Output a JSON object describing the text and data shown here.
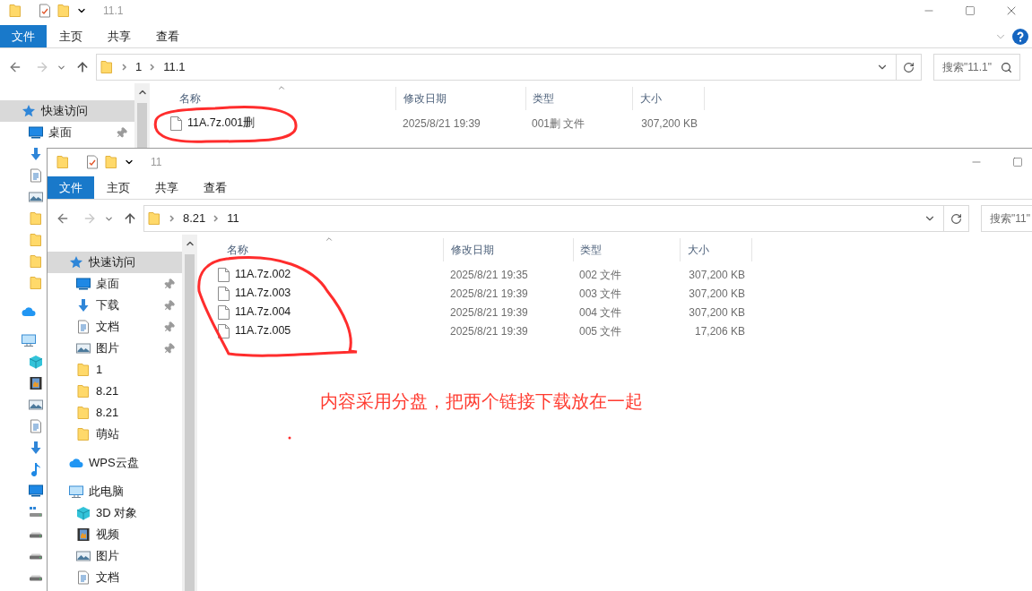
{
  "windows": [
    {
      "title": "11.1",
      "ribbon": {
        "tabs": [
          {
            "label": "文件",
            "selected": true
          },
          {
            "label": "主页",
            "selected": false
          },
          {
            "label": "共享",
            "selected": false
          },
          {
            "label": "查看",
            "selected": false
          }
        ]
      },
      "breadcrumb": [
        "1",
        "11.1"
      ],
      "search": {
        "placeholder": "搜索\"11.1\""
      },
      "sidebar": [
        {
          "kind": "star",
          "label": "快速访问",
          "selected": true,
          "children": [
            {
              "kind": "desktop",
              "label": "桌面",
              "pinned": true,
              "selected": false
            },
            {
              "kind": "download",
              "selected": false
            },
            {
              "kind": "document",
              "selected": false
            },
            {
              "kind": "picture",
              "selected": false
            },
            {
              "kind": "folder",
              "selected": false
            },
            {
              "kind": "folder",
              "selected": false
            },
            {
              "kind": "folder",
              "selected": false
            },
            {
              "kind": "folder",
              "selected": false
            }
          ]
        },
        {
          "kind": "cloud",
          "selected": false
        },
        {
          "kind": "pc",
          "selected": false,
          "children": [
            {
              "kind": "cube",
              "selected": false
            },
            {
              "kind": "video",
              "selected": false
            },
            {
              "kind": "picture",
              "selected": false
            },
            {
              "kind": "document",
              "selected": false
            },
            {
              "kind": "download",
              "selected": false
            },
            {
              "kind": "music",
              "selected": false
            },
            {
              "kind": "desktop",
              "selected": false
            },
            {
              "kind": "netdrive",
              "selected": false
            },
            {
              "kind": "drive",
              "selected": false
            },
            {
              "kind": "drive",
              "selected": false
            },
            {
              "kind": "drive",
              "selected": false
            }
          ]
        }
      ],
      "columns": [
        "名称",
        "修改日期",
        "类型",
        "大小"
      ],
      "rows": [
        {
          "name": "11A.7z.001删",
          "date": "2025/8/21 19:39",
          "type": "001删 文件",
          "size": "307,200 KB"
        }
      ]
    },
    {
      "title": "11",
      "ribbon": {
        "tabs": [
          {
            "label": "文件",
            "selected": true
          },
          {
            "label": "主页",
            "selected": false
          },
          {
            "label": "共享",
            "selected": false
          },
          {
            "label": "查看",
            "selected": false
          }
        ]
      },
      "breadcrumb": [
        "8.21",
        "11"
      ],
      "search": {
        "placeholder": "搜索\"11\""
      },
      "sidebar": [
        {
          "kind": "star",
          "label": "快速访问",
          "selected": true,
          "children": [
            {
              "kind": "desktop",
              "label": "桌面",
              "pinned": true,
              "selected": false
            },
            {
              "kind": "download",
              "label": "下载",
              "pinned": true,
              "selected": false
            },
            {
              "kind": "document",
              "label": "文档",
              "pinned": true,
              "selected": false
            },
            {
              "kind": "picture",
              "label": "图片",
              "pinned": true,
              "selected": false
            },
            {
              "kind": "folder",
              "label": "1",
              "pinned": false,
              "selected": false
            },
            {
              "kind": "folder",
              "label": "8.21",
              "pinned": false,
              "selected": false
            },
            {
              "kind": "folder",
              "label": "8.21",
              "pinned": false,
              "selected": false
            },
            {
              "kind": "folder",
              "label": "萌站",
              "pinned": false,
              "selected": false
            }
          ]
        },
        {
          "kind": "cloud",
          "label": "WPS云盘",
          "selected": false
        },
        {
          "kind": "pc",
          "label": "此电脑",
          "selected": false,
          "children": [
            {
              "kind": "cube",
              "label": "3D 对象",
              "selected": false
            },
            {
              "kind": "video",
              "label": "视频",
              "selected": false
            },
            {
              "kind": "picture",
              "label": "图片",
              "selected": false
            },
            {
              "kind": "document",
              "label": "文档",
              "selected": false
            }
          ]
        }
      ],
      "columns": [
        "名称",
        "修改日期",
        "类型",
        "大小"
      ],
      "rows": [
        {
          "name": "11A.7z.002",
          "date": "2025/8/21 19:35",
          "type": "002 文件",
          "size": "307,200 KB"
        },
        {
          "name": "11A.7z.003",
          "date": "2025/8/21 19:39",
          "type": "003 文件",
          "size": "307,200 KB"
        },
        {
          "name": "11A.7z.004",
          "date": "2025/8/21 19:39",
          "type": "004 文件",
          "size": "307,200 KB"
        },
        {
          "name": "11A.7z.005",
          "date": "2025/8/21 19:39",
          "type": "005 文件",
          "size": "17,206 KB"
        }
      ]
    }
  ],
  "annotation": {
    "text": "内容采用分盘，把两个链接下载放在一起"
  }
}
